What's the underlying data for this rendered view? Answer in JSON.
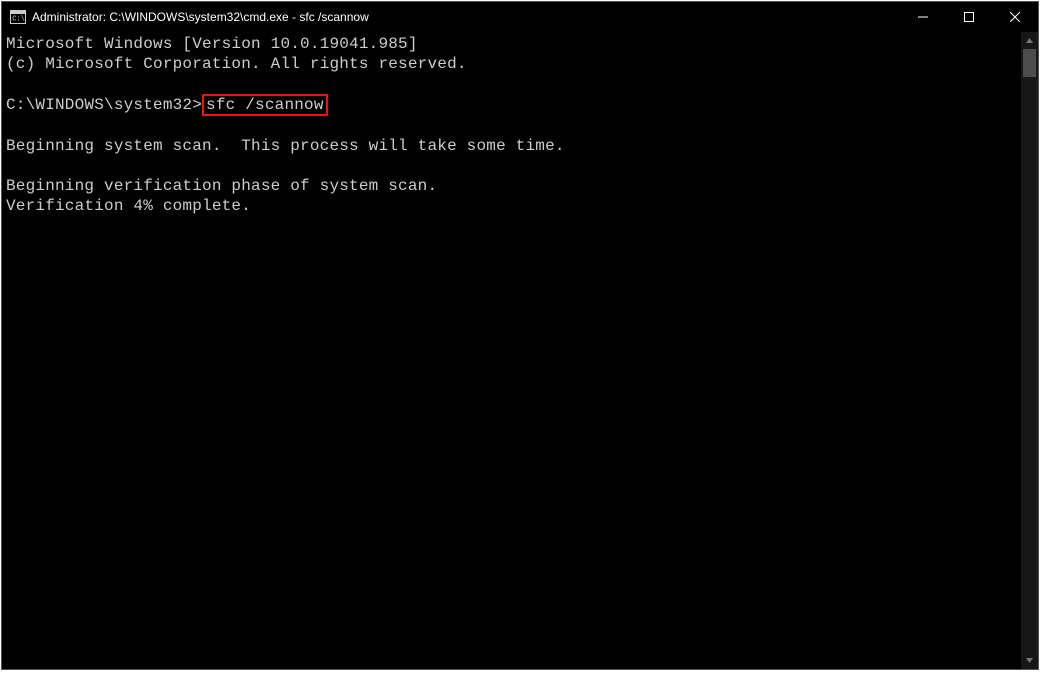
{
  "window": {
    "title": "Administrator: C:\\WINDOWS\\system32\\cmd.exe - sfc  /scannow"
  },
  "terminal": {
    "line1": "Microsoft Windows [Version 10.0.19041.985]",
    "line2": "(c) Microsoft Corporation. All rights reserved.",
    "prompt": "C:\\WINDOWS\\system32>",
    "cmd": "sfc /scannow",
    "line5": "Beginning system scan.  This process will take some time.",
    "line7": "Beginning verification phase of system scan.",
    "line8": "Verification 4% complete."
  }
}
